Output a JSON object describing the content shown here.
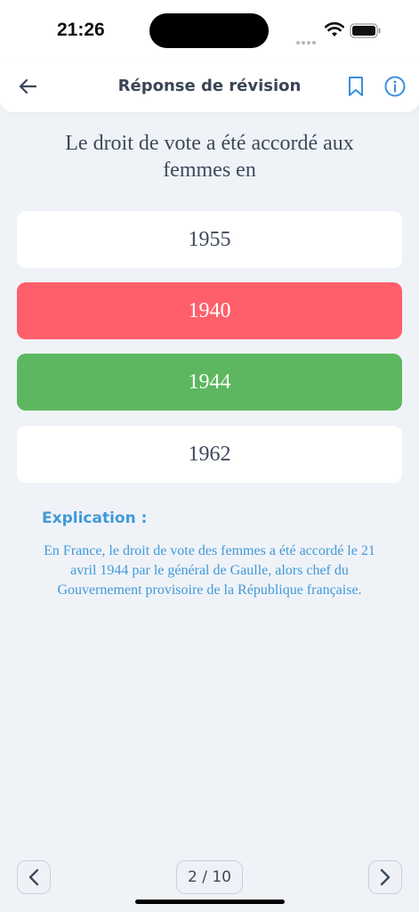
{
  "status_bar": {
    "time": "21:26"
  },
  "header": {
    "title": "Réponse de révision",
    "back_icon": "arrow-left-icon",
    "bookmark_icon": "bookmark-icon",
    "info_icon": "info-icon",
    "accent_color": "#3a8fde"
  },
  "question": {
    "text": "Le droit de vote a été accordé aux femmes en"
  },
  "answers": [
    {
      "label": "1955",
      "state": "neutral"
    },
    {
      "label": "1940",
      "state": "wrong",
      "color": "#ff5f6b"
    },
    {
      "label": "1944",
      "state": "correct",
      "color": "#5db760"
    },
    {
      "label": "1962",
      "state": "neutral"
    }
  ],
  "explanation": {
    "title": "Explication :",
    "text": "En France, le droit de vote des femmes a été accordé le 21 avril 1944 par le général de Gaulle, alors chef du Gouvernement provisoire de la République française.",
    "color": "#4199d8"
  },
  "pagination": {
    "indicator": "2 / 10",
    "prev_icon": "chevron-left-icon",
    "next_icon": "chevron-right-icon"
  }
}
